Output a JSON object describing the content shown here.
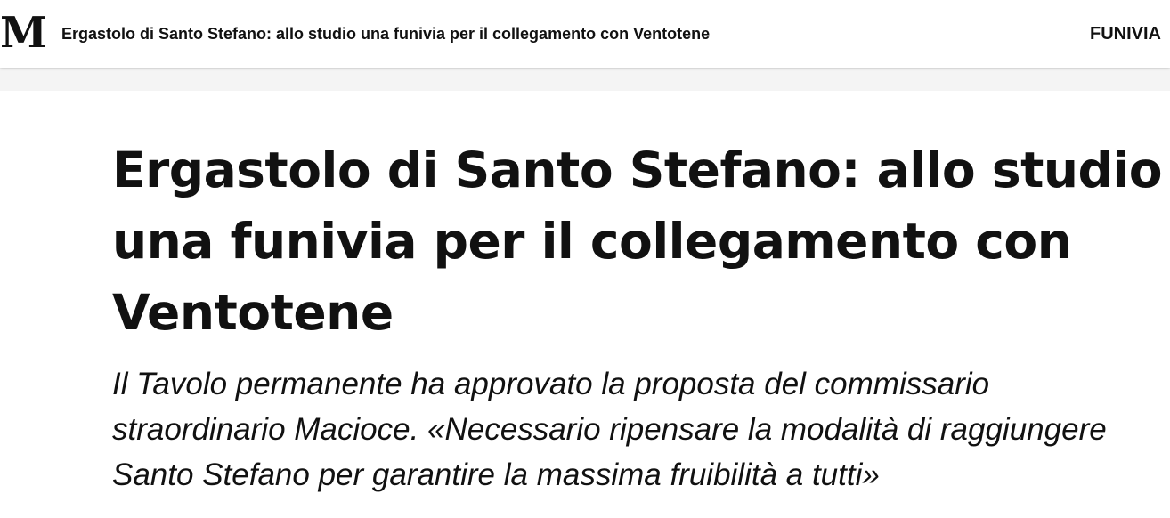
{
  "header": {
    "logo_text": "M",
    "title": "Ergastolo di Santo Stefano: allo studio una funivia per il collegamento con Ventotene",
    "section_label": "FUNIVIA"
  },
  "article": {
    "headline": "Ergastolo di Santo Stefano: allo studio una funivia per il collegamento con Ventotene",
    "subtitle": "Il Tavolo permanente ha approvato la proposta del commissario straordinario Macioce. «Necessario ripensare la modalità di raggiungere Santo Stefano per garantire la massima fruibilità a tutti»"
  }
}
